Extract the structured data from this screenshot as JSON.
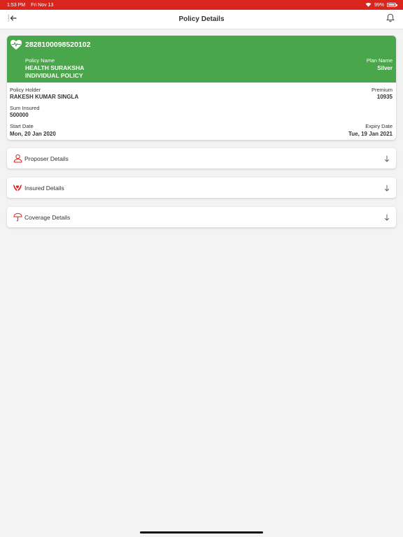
{
  "status_bar": {
    "time": "1:53 PM",
    "date": "Fri Nov 13",
    "battery": "99%",
    "battery_level": 0.99,
    "background": "#d9251d"
  },
  "nav": {
    "title": "Policy Details",
    "back_icon": "arrow-left-icon",
    "bell_icon": "bell-icon"
  },
  "policy": {
    "number": "2828100098520102",
    "icon": "heart-pulse-icon",
    "accent": "#4aa64a",
    "policy_name_label": "Policy Name",
    "policy_name_line1": "HEALTH SURAKSHA",
    "policy_name_line2": "INDIVIDUAL POLICY",
    "plan_name_label": "Plan Name",
    "plan_name": "Silver",
    "policy_holder_label": "Policy Holder",
    "policy_holder": "RAKESH KUMAR SINGLA",
    "premium_label": "Premium",
    "premium": "10935",
    "sum_insured_label": "Sum Insured",
    "sum_insured": "500000",
    "start_date_label": "Start Date",
    "start_date": "Mon, 20 Jan 2020",
    "expiry_date_label": "Expiry Date",
    "expiry_date": "Tue, 19 Jan 2021"
  },
  "sections": [
    {
      "label": "Proposer Details",
      "icon": "person-icon"
    },
    {
      "label": "Insured Details",
      "icon": "hands-care-icon"
    },
    {
      "label": "Coverage Details",
      "icon": "umbrella-icon"
    }
  ],
  "icon_color": "#d9251d"
}
